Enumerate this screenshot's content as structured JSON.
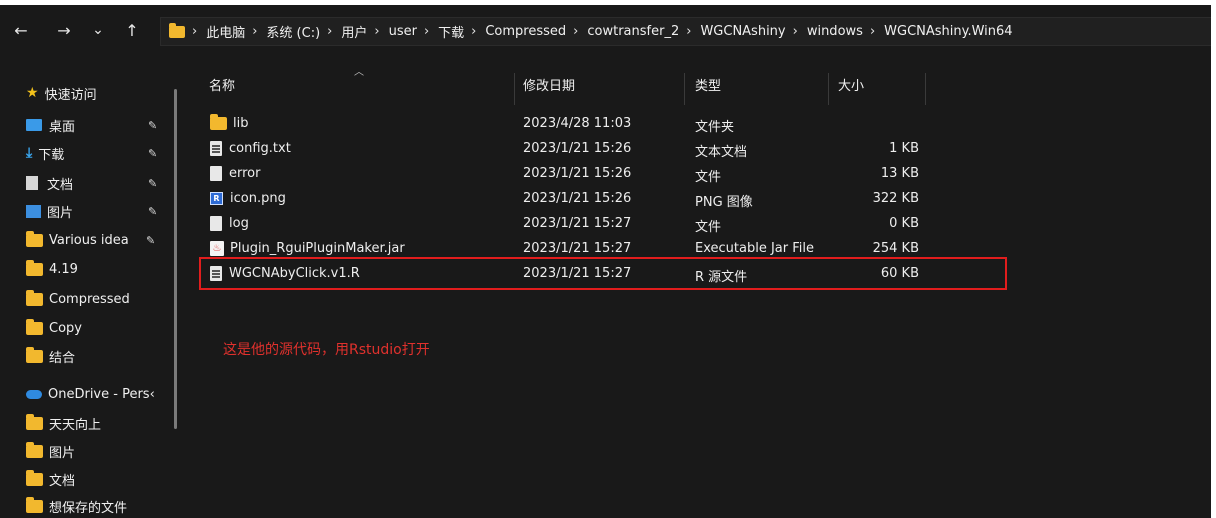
{
  "nav": {
    "back": "←",
    "forward": "→",
    "recent": "⌄",
    "up": "↑"
  },
  "breadcrumb": [
    "此电脑",
    "系统 (C:)",
    "用户",
    "user",
    "下载",
    "Compressed",
    "cowtransfer_2",
    "WGCNAshiny",
    "windows",
    "WGCNAshiny.Win64"
  ],
  "sidebar": {
    "quick_access": "快速访问",
    "items": [
      {
        "label": "桌面",
        "icon": "desktop-icon"
      },
      {
        "label": "下载",
        "icon": "download-icon"
      },
      {
        "label": "文档",
        "icon": "documents-icon"
      },
      {
        "label": "图片",
        "icon": "pictures-icon"
      },
      {
        "label": "Various idea",
        "icon": "folder-icon"
      },
      {
        "label": "4.19",
        "icon": "folder-icon"
      },
      {
        "label": "Compressed",
        "icon": "folder-icon"
      },
      {
        "label": "Copy",
        "icon": "folder-icon"
      },
      {
        "label": "结合",
        "icon": "folder-icon"
      }
    ],
    "onedrive": "OneDrive - Pers‹",
    "onedrive_items": [
      {
        "label": "天天向上"
      },
      {
        "label": "图片"
      },
      {
        "label": "文档"
      },
      {
        "label": "想保存的文件"
      }
    ]
  },
  "columns": {
    "name": "名称",
    "date": "修改日期",
    "type": "类型",
    "size": "大小"
  },
  "files": [
    {
      "name": "lib",
      "date": "2023/4/28 11:03",
      "type": "文件夹",
      "size": "",
      "icon": "folder"
    },
    {
      "name": "config.txt",
      "date": "2023/1/21 15:26",
      "type": "文本文档",
      "size": "1 KB",
      "icon": "text"
    },
    {
      "name": "error",
      "date": "2023/1/21 15:26",
      "type": "文件",
      "size": "13 KB",
      "icon": "file"
    },
    {
      "name": "icon.png",
      "date": "2023/1/21 15:26",
      "type": "PNG 图像",
      "size": "322 KB",
      "icon": "image"
    },
    {
      "name": "log",
      "date": "2023/1/21 15:27",
      "type": "文件",
      "size": "0 KB",
      "icon": "file"
    },
    {
      "name": "Plugin_RguiPluginMaker.jar",
      "date": "2023/1/21 15:27",
      "type": "Executable Jar File",
      "size": "254 KB",
      "icon": "jar"
    },
    {
      "name": "WGCNAbyClick.v1.R",
      "date": "2023/1/21 15:27",
      "type": "R 源文件",
      "size": "60 KB",
      "icon": "text"
    }
  ],
  "annotation": "这是他的源代码，用Rstudio打开",
  "colors": {
    "background": "#191919",
    "folder": "#f2b82e",
    "highlight": "#e11d1d",
    "annotation": "#e0312d"
  }
}
